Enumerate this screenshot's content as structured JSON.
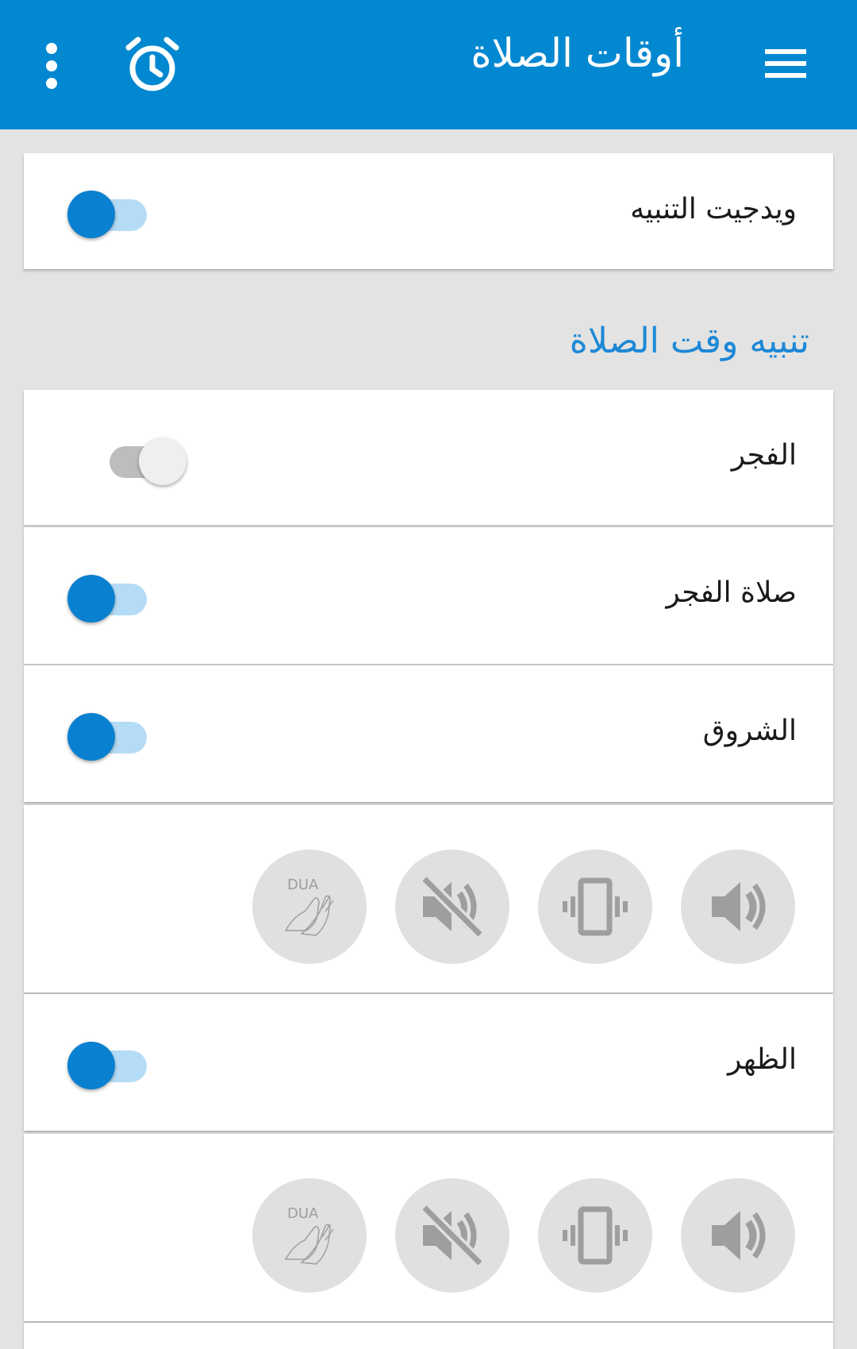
{
  "app_bar": {
    "title": "أوقات الصلاة",
    "menu_icon": "hamburger-menu-icon",
    "alarm_icon": "alarm-clock-icon",
    "overflow_icon": "more-vertical-icon",
    "color": "#0288d1"
  },
  "widget_row": {
    "label": "ويدجيت التنبيه",
    "enabled": true
  },
  "section": {
    "title": "تنبيه وقت الصلاة"
  },
  "prayers": [
    {
      "label": "الفجر",
      "enabled": false
    },
    {
      "label": "صلاة الفجر",
      "enabled": true
    },
    {
      "label": "الشروق",
      "enabled": true
    },
    {
      "label": "الظهر",
      "enabled": true
    }
  ],
  "sound_controls": {
    "icons": [
      "volume-up-icon",
      "vibrate-icon",
      "mute-icon",
      "dua-hands-icon"
    ],
    "dua_text": "DUA"
  },
  "colors": {
    "accent": "#0a80d0",
    "track_on": "#b5dcf6",
    "section_header": "#1e88d6"
  }
}
